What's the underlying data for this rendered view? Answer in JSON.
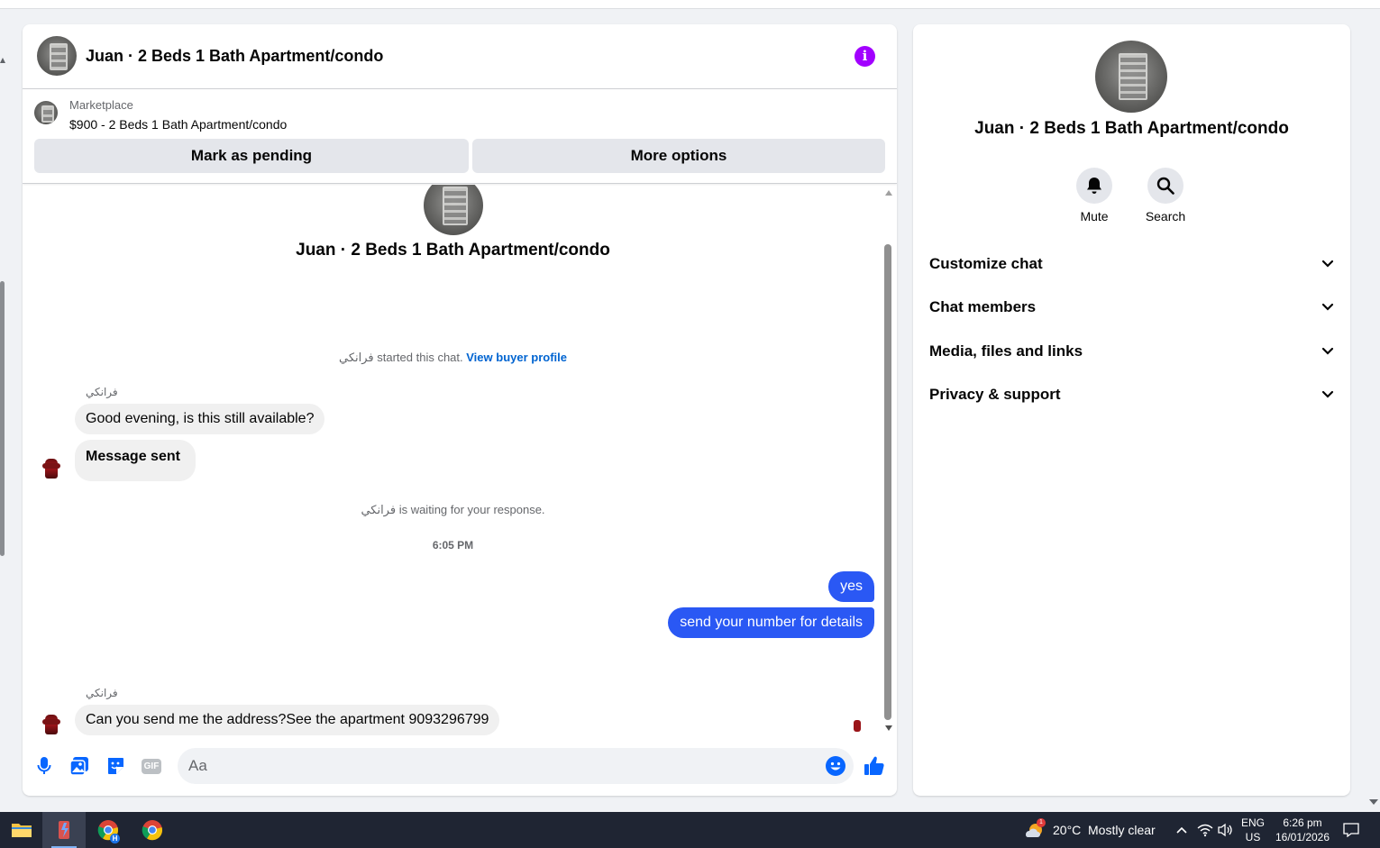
{
  "header": {
    "title": "Juan · 2 Beds 1 Bath Apartment/condo"
  },
  "marketplace": {
    "label": "Marketplace",
    "listing": "$900 - 2 Beds 1 Bath Apartment/condo",
    "mark_pending_label": "Mark as pending",
    "more_options_label": "More options"
  },
  "conversation": {
    "title": "Juan · 2 Beds 1 Bath Apartment/condo",
    "buyer_name": "فرانكي",
    "started_text": " started this chat. ",
    "view_profile_label": "View buyer profile",
    "waiting_text": " is waiting for your response.",
    "time_separator": "6:05 PM",
    "messages": [
      {
        "text": "Good evening, is this still available?"
      },
      {
        "text": "Message sent"
      },
      {
        "text": "yes"
      },
      {
        "text": "send your number for details"
      },
      {
        "text": "Can you send me the address?See the apartment 9093296799"
      }
    ]
  },
  "composer": {
    "placeholder": "Aa",
    "gif_label": "GIF"
  },
  "details": {
    "title": "Juan · 2 Beds 1 Bath Apartment/condo",
    "mute_label": "Mute",
    "search_label": "Search",
    "sections": [
      {
        "label": "Customize chat"
      },
      {
        "label": "Chat members"
      },
      {
        "label": "Media, files and links"
      },
      {
        "label": "Privacy & support"
      }
    ]
  },
  "taskbar": {
    "weather_temp": "20°C",
    "weather_desc": "Mostly clear",
    "weather_badge": "1",
    "chrome_badge": "H",
    "lang": "ENG",
    "region": "US",
    "time": "6:26 pm",
    "date": "16/01/2026"
  },
  "colors": {
    "accent": "#2a58f4",
    "info_icon": "#a200ff",
    "link": "#0064d1"
  }
}
